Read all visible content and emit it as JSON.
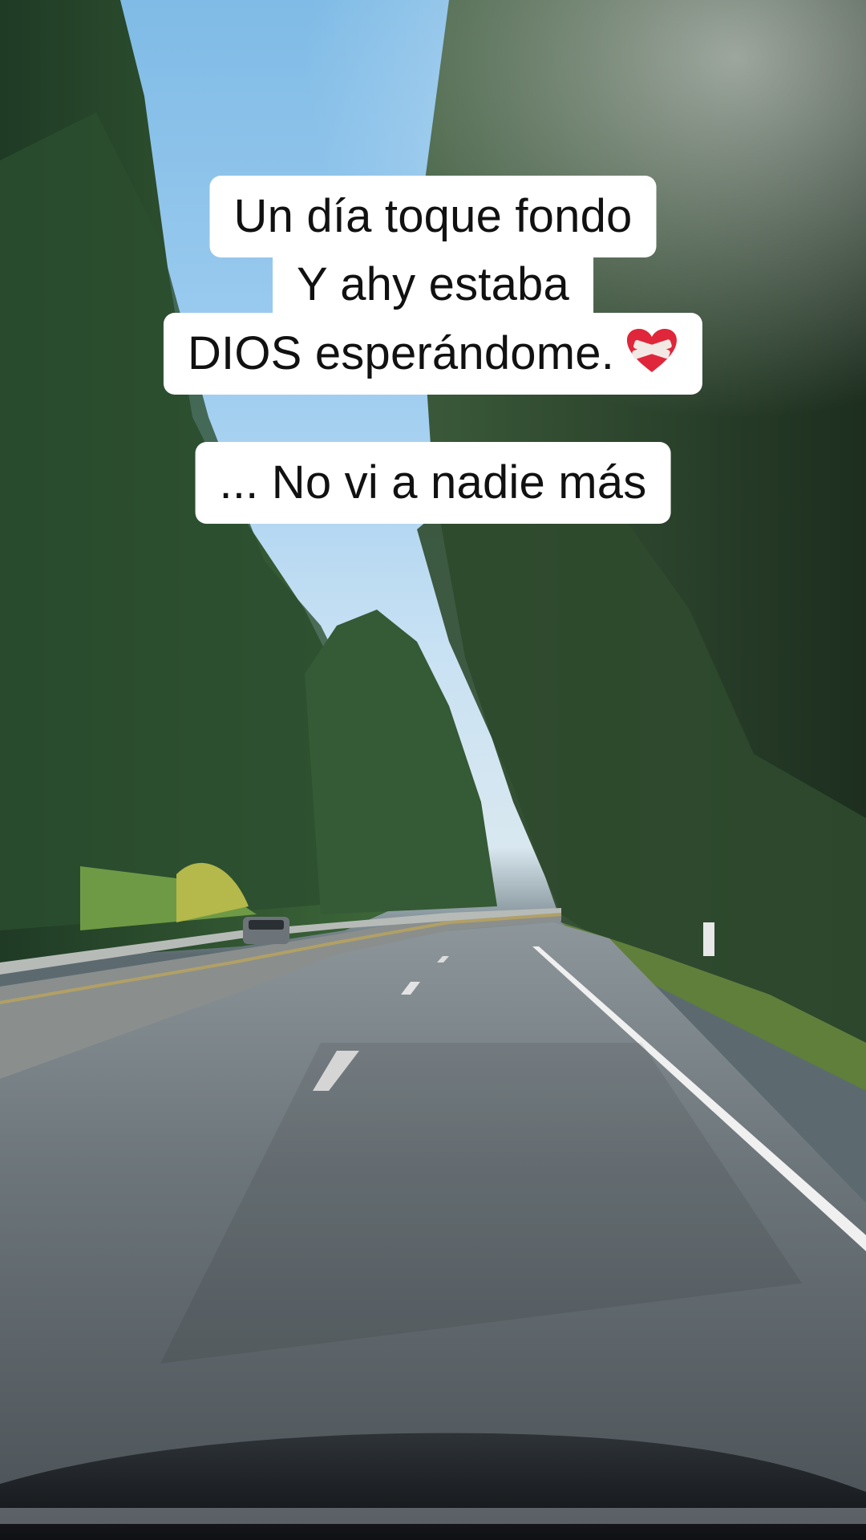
{
  "caption": {
    "lines": [
      "Un día toque fondo",
      "Y ahy estaba",
      "DIOS esperándome.",
      "... No vi a nadie más"
    ],
    "emoji_icon": "mending-heart-icon",
    "background_color": "#ffffff",
    "text_color": "#111111"
  },
  "scene": {
    "description_icon": "road-forest-scene"
  }
}
